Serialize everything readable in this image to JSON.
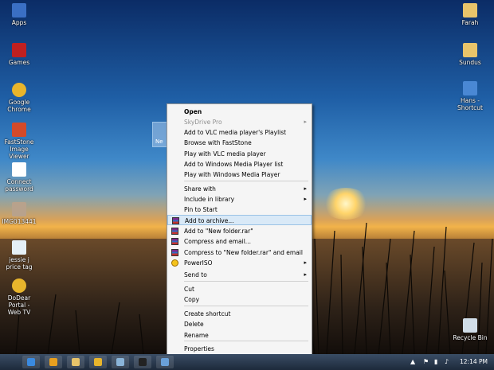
{
  "desktop": {
    "icons_left": [
      {
        "label": "Apps",
        "icon": "monitor-icon",
        "color": "#3a6fc4"
      },
      {
        "label": "Games",
        "icon": "games-icon",
        "color": "#c02020"
      },
      {
        "label": "Google Chrome",
        "icon": "chrome-icon",
        "color": "#e8b52c"
      },
      {
        "label": "FastStone Image Viewer",
        "icon": "faststone-icon",
        "color": "#d44a2a"
      },
      {
        "label": "Connect password",
        "icon": "document-icon",
        "color": "#ffffff"
      },
      {
        "label": "IMG013441",
        "icon": "image-icon",
        "color": "#b8a28c"
      },
      {
        "label": "jessie j price tag",
        "icon": "music-file-icon",
        "color": "#e6f0f6"
      },
      {
        "label": "DoDear Portal - Web TV",
        "icon": "chrome-icon",
        "color": "#e8b52c"
      }
    ],
    "icons_right": [
      {
        "label": "Farah",
        "icon": "folder-icon",
        "color": "#e8c46a"
      },
      {
        "label": "Sundus",
        "icon": "shortcut-icon",
        "color": "#e8c46a"
      },
      {
        "label": "Hans - Shortcut",
        "icon": "shortcut-icon",
        "color": "#4a88d4"
      },
      {
        "label": "Recycle Bin",
        "icon": "recycle-bin-icon",
        "color": "#d0dde8"
      }
    ],
    "selected_folder_label": "Ne"
  },
  "context_menu": {
    "items": [
      {
        "label": "Open",
        "bold": true
      },
      {
        "label": "SkyDrive Pro",
        "disabled": true,
        "submenu": true
      },
      {
        "label": "Add to VLC media player's Playlist"
      },
      {
        "label": "Browse with FastStone"
      },
      {
        "label": "Play with VLC media player"
      },
      {
        "label": "Add to Windows Media Player list"
      },
      {
        "label": "Play with Windows Media Player"
      },
      {
        "label": "Share with",
        "submenu": true
      },
      {
        "label": "Include in library",
        "submenu": true
      },
      {
        "label": "Pin to Start"
      },
      {
        "label": "Add to archive...",
        "highlighted": true,
        "icon": "winrar-icon"
      },
      {
        "label": "Add to \"New folder.rar\"",
        "icon": "winrar-icon"
      },
      {
        "label": "Compress and email...",
        "icon": "winrar-icon"
      },
      {
        "label": "Compress to \"New folder.rar\" and email",
        "icon": "winrar-icon"
      },
      {
        "label": "PowerISO",
        "submenu": true,
        "icon": "poweriso-icon"
      },
      {
        "label": "Send to",
        "submenu": true
      },
      {
        "label": "Cut"
      },
      {
        "label": "Copy"
      },
      {
        "label": "Create shortcut"
      },
      {
        "label": "Delete"
      },
      {
        "label": "Rename"
      },
      {
        "label": "Properties"
      }
    ],
    "submenu_arrow": "▸"
  },
  "taskbar": {
    "clock": "12:14 PM",
    "buttons": [
      {
        "icon": "ie-icon",
        "color": "#3a8ae0"
      },
      {
        "icon": "media-player-icon",
        "color": "#e8a020"
      },
      {
        "icon": "explorer-icon",
        "color": "#e8c46a"
      },
      {
        "icon": "chrome-icon",
        "color": "#e8b52c"
      },
      {
        "icon": "app-icon",
        "color": "#8ab4d8"
      },
      {
        "icon": "cmd-icon",
        "color": "#222222"
      },
      {
        "icon": "picture-icon",
        "color": "#6aa0d8"
      }
    ],
    "tray_icons": [
      "chevron-up-icon",
      "flag-icon",
      "network-icon",
      "volume-icon"
    ]
  }
}
